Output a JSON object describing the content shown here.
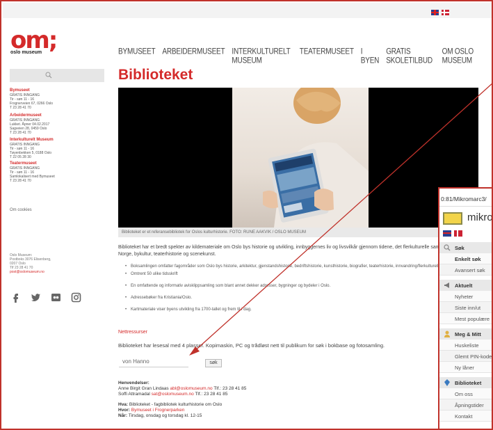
{
  "logo": {
    "main": "om;",
    "sub": "oslo museum"
  },
  "nav": [
    "BYMUSEET",
    "ARBEIDERMUSEET",
    "INTERKULTURELT MUSEUM",
    "TEATERMUSEET",
    "I BYEN",
    "GRATIS SKOLETILBUD",
    "OM OSLO MUSEUM"
  ],
  "sidebar": {
    "museums": [
      {
        "title": "Bymuseet",
        "lines": [
          "GRATIS INNGANG",
          "Tir - søn 11 - 16",
          "Frognerveien 67, 0266 Oslo",
          "T 23 28 41 70"
        ]
      },
      {
        "title": "Arbeidermuseet",
        "lines": [
          "GRATIS INNGANG",
          "Lukket. Åpner 04.02.2017",
          "Sagveien 28, 0459 Oslo",
          "T 23 28 41 70"
        ]
      },
      {
        "title": "Interkulturelt Museum",
        "lines": [
          "GRATIS INNGANG",
          "Tir - søn 11 - 16",
          "Tøyenbekken 5, 0188 Oslo",
          "T 22 05 28 30"
        ]
      },
      {
        "title": "Teatermuseet",
        "lines": [
          "GRATIS INNGANG",
          "Tir - søn 11 - 16",
          "Samlokalisert med Bymuseet",
          "T 23 28 41 70"
        ]
      }
    ],
    "cookies": "Om cookies",
    "postal": [
      "Oslo Museum:",
      "Postboks 3076 Elisenberg,",
      "0207 Oslo",
      "Tlf 23 28 41 70"
    ],
    "email": "post@oslomuseum.no"
  },
  "page": {
    "title": "Biblioteket",
    "caption": "Biblioteket er et referansebibliotek for Oslos kulturhistorie. FOTO: RUNE AAKVIK / OSLO MUSEUM",
    "intro": "Biblioteket har et bredt spekter av kildemateriale om Oslo bys historie og utvikling, innbyggernes liv og livsvilkår gjennom tidene, det flerkulturelle samfunn og innvandring i Norge, bykultur, teaterhistorie og scenekunst.",
    "bullets": [
      "Boksamlingen omfatter fagområder som Oslo bys historie, arkitektur, gjenstandshistorie, bedriftshistorie, kunsthistorie, biografier, teaterhistorie, innvandring/flerkulturelle samfunn",
      "Omtrent 50 ulike tidsskrift",
      "En omfattende og informativ avisklippsamling som blant annet dekker adresser, bygninger og bydeler i Oslo.",
      "Adressebøker fra Kristiania/Oslo.",
      "Kartmateriale viser byens utvikling fra 1700-tallet og frem til i dag."
    ],
    "netres": "Nettressurser",
    "lesesal": "Biblioteket har lesesal med 4 plasser. Kopimaskin, PC og trådløst nett til publikum for søk i bokbase og fotosamling.",
    "search_value": "von Hanno",
    "search_button": "søk",
    "contacts": {
      "heading": "Henvendelser:",
      "p1_name": "Anne Birgit Gran Lindaas",
      "p1_email": "abl@oslomuseum.no",
      "p1_tel": "Tlf.: 23 28 41 85",
      "p2_name": "Soffi Attramadal",
      "p2_email": "sat@oslomuseum.no",
      "p2_tel": "Tlf.: 23 28 41 85",
      "what_label": "Hva:",
      "what_value": "Biblioteket - fagbibliotek kulturhistorie om Oslo",
      "where_label": "Hvor:",
      "where_value": "Bymuseet i Frognerparken",
      "when_label": "Når:",
      "when_value": "Tirsdag, onsdag og torsdag kl. 12-15"
    }
  },
  "popup": {
    "url": "0:81/Mikromarc3/",
    "logo_text": "mikro",
    "sections": [
      {
        "title": "Søk",
        "items": [
          "Enkelt søk",
          "Avansert søk"
        ]
      },
      {
        "title": "Aktuelt",
        "items": [
          "Nyheter",
          "Siste inn/ut",
          "Mest populære"
        ]
      },
      {
        "title": "Meg & Mitt",
        "items": [
          "Huskeliste",
          "Glemt PIN-kode",
          "Ny låner"
        ]
      },
      {
        "title": "Biblioteket",
        "items": [
          "Om oss",
          "Åpningstider",
          "Kontakt"
        ]
      }
    ]
  },
  "colors": {
    "accent": "#d42a2a",
    "annotation": "#c0322b"
  }
}
